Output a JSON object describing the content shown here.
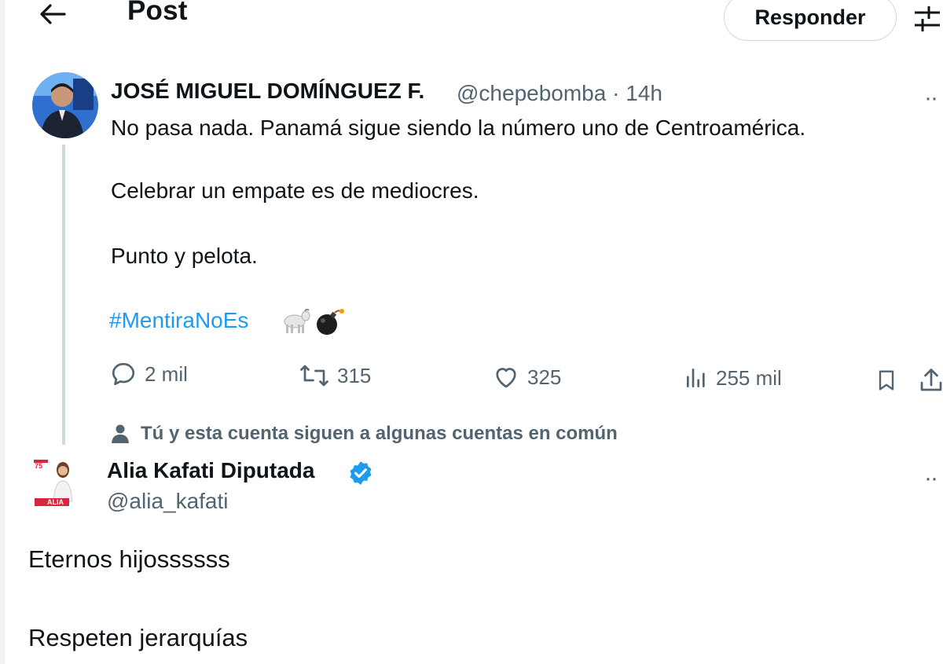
{
  "header": {
    "title": "Post",
    "reply_button": "Responder"
  },
  "tweet": {
    "author_name": "JOSÉ MIGUEL DOMÍNGUEZ F.",
    "author_meta": "@chepebomba · 14h",
    "lines": [
      "No pasa nada. Panamá sigue siendo la número uno de Centroamérica.",
      "Celebrar un empate es de mediocres.",
      "Punto y pelota."
    ],
    "hashtag": "#MentiraNoEs",
    "emojis": [
      "goat-emoji",
      "bomb-emoji"
    ],
    "stats": {
      "replies": "2 mil",
      "reposts": "315",
      "likes": "325",
      "views": "255 mil"
    }
  },
  "social_context": "Tú y esta cuenta siguen a algunas cuentas en común",
  "reply": {
    "author_name": "Alia Kafati Diputada",
    "author_handle": "@alia_kafati",
    "lines": [
      "Eternos hijossssss",
      "Respeten jerarquías"
    ]
  },
  "colors": {
    "text": "#0f1419",
    "secondary": "#536471",
    "link": "#1d9bf0",
    "verified": "#1d9bf0",
    "border": "#cfd9de"
  }
}
